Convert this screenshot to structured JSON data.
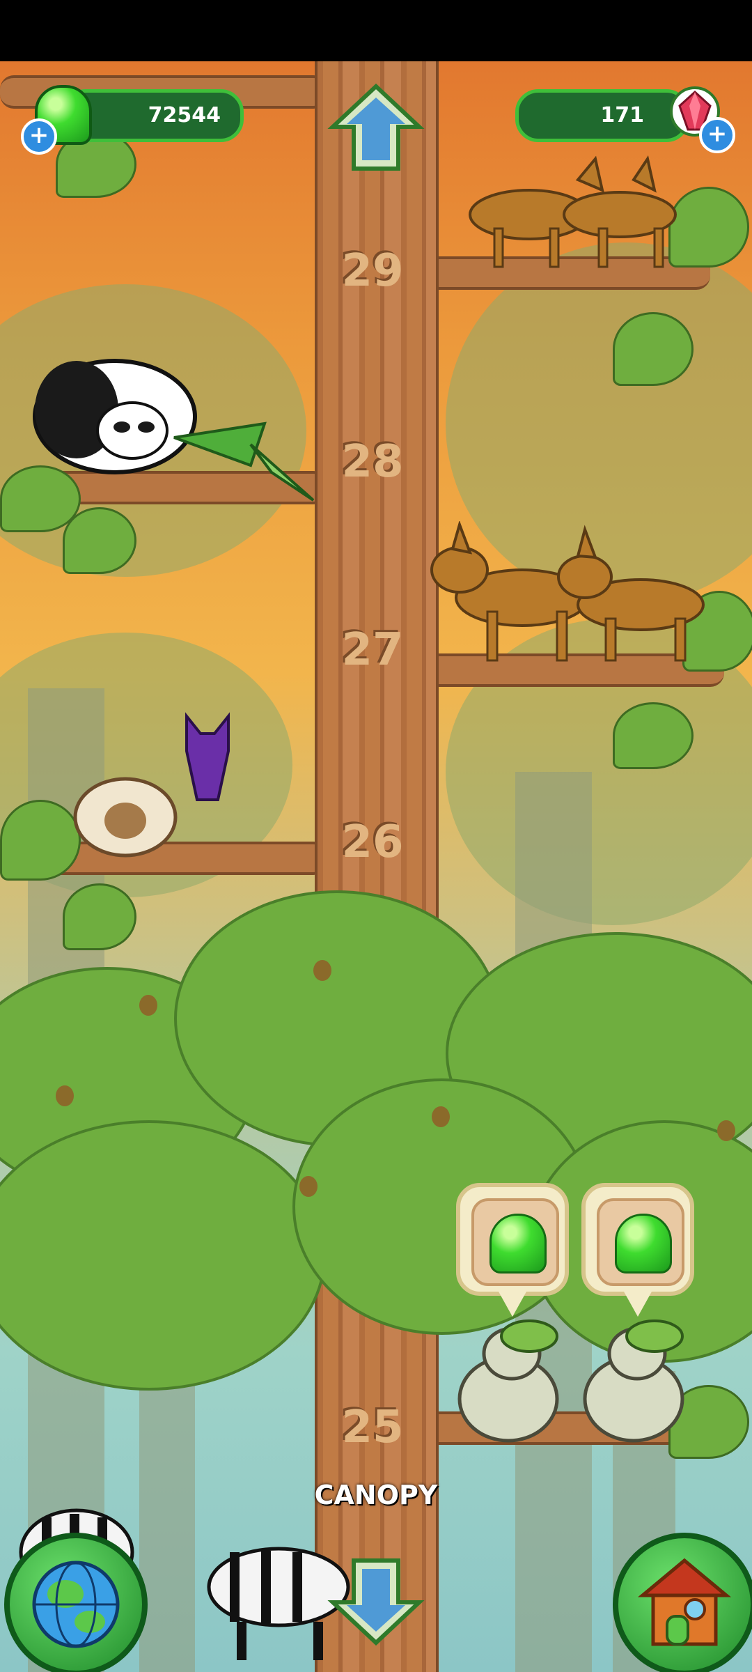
{
  "hud": {
    "jelly_count": "72544",
    "gem_count": "171",
    "add_jelly_label": "+",
    "add_gem_label": "+"
  },
  "levels": [
    "29",
    "28",
    "27",
    "26",
    "25"
  ],
  "biome_label": "CANOPY",
  "colors": {
    "sky_orange": "#e2782f",
    "trunk": "#b87643",
    "leaf": "#6fae3f",
    "hud_green": "#1f6a2e",
    "jelly_green": "#3fdc2f"
  },
  "icons": {
    "up": "arrow-up-icon",
    "down": "arrow-down-icon",
    "globe": "globe-icon",
    "house": "house-icon",
    "jelly": "jelly-icon",
    "gem": "gem-icon"
  }
}
